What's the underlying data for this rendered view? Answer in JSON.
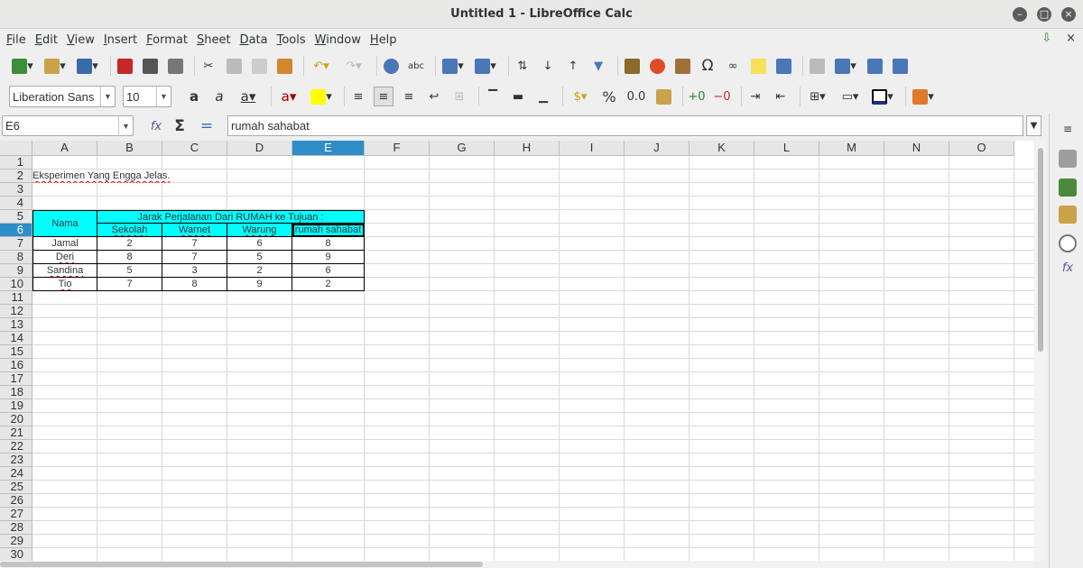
{
  "window": {
    "title": "Untitled 1 - LibreOffice Calc"
  },
  "menu": [
    {
      "label": "File"
    },
    {
      "label": "Edit"
    },
    {
      "label": "View"
    },
    {
      "label": "Insert"
    },
    {
      "label": "Format"
    },
    {
      "label": "Sheet"
    },
    {
      "label": "Data"
    },
    {
      "label": "Tools"
    },
    {
      "label": "Window"
    },
    {
      "label": "Help"
    }
  ],
  "font": {
    "name": "Liberation Sans",
    "size": "10"
  },
  "formula": {
    "cell_ref": "E6",
    "content": "rumah sahabat"
  },
  "columns": [
    "A",
    "B",
    "C",
    "D",
    "E",
    "F",
    "G",
    "H",
    "I",
    "J",
    "K",
    "L",
    "M",
    "N",
    "O"
  ],
  "selected_column": "E",
  "rows": [
    "1",
    "2",
    "3",
    "4",
    "5",
    "6",
    "7",
    "8",
    "9",
    "10",
    "11",
    "12",
    "13",
    "14",
    "15",
    "16",
    "17",
    "18",
    "19",
    "20",
    "21",
    "22",
    "23",
    "24",
    "25",
    "26",
    "27",
    "28",
    "29",
    "30"
  ],
  "selected_row": "6",
  "sheet": {
    "title": "Eksperimen Yang Engga Jelas.",
    "header_main": "Jarak Perjalanan Dari RUMAH ke Tujuan :",
    "header_nama": "Nama",
    "subheaders": [
      "Sekolah",
      "Warnet",
      "Warung",
      "rumah sahabat"
    ],
    "data": [
      {
        "name": "Jamal",
        "values": [
          "2",
          "7",
          "6",
          "8"
        ]
      },
      {
        "name": "Deri",
        "values": [
          "8",
          "7",
          "5",
          "9"
        ]
      },
      {
        "name": "Sandina",
        "values": [
          "5",
          "3",
          "2",
          "6"
        ]
      },
      {
        "name": "Tio",
        "values": [
          "7",
          "8",
          "9",
          "2"
        ]
      }
    ]
  },
  "colors": {
    "header_fill": "#00ffff",
    "selection": "#2f8ec8"
  }
}
